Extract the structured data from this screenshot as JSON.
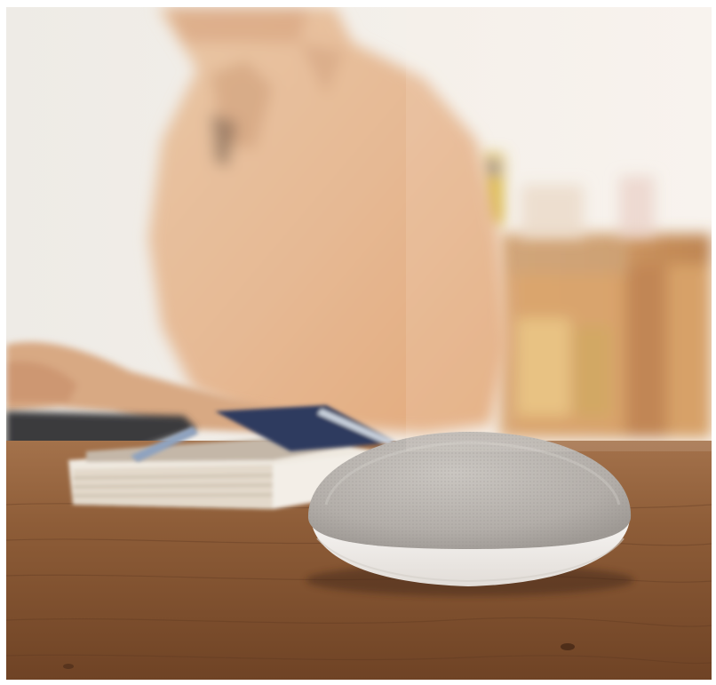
{
  "photo": {
    "scene": "smart-speaker-on-table",
    "palette": {
      "wall": "#f2eee8",
      "shirt": "#e7bf9c",
      "table": "#8a5a36",
      "speaker_fabric": "#bdb8b3",
      "speaker_base": "#f4f1ee",
      "shelf": "#c68446"
    }
  }
}
